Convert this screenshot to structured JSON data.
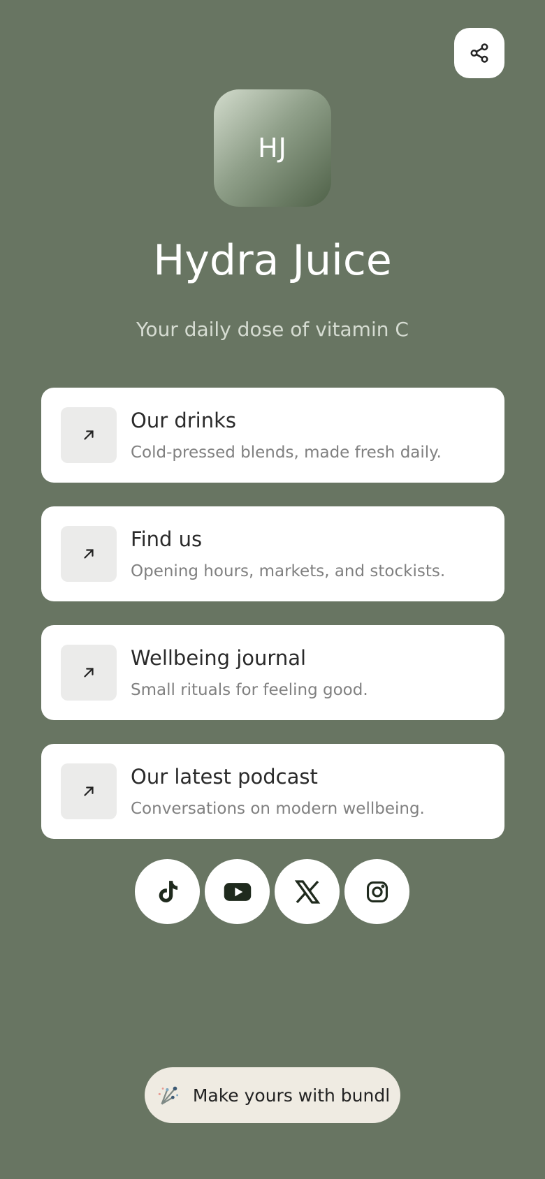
{
  "profile": {
    "initials": "HJ",
    "name": "Hydra Juice",
    "tagline": "Your daily dose of vitamin C"
  },
  "links": [
    {
      "title": "Our drinks",
      "description": "Cold-pressed blends, made fresh daily.",
      "icon": "arrow-up-right-icon"
    },
    {
      "title": "Find us",
      "description": "Opening hours, markets, and stockists.",
      "icon": "arrow-up-right-icon"
    },
    {
      "title": "Wellbeing journal",
      "description": "Small rituals for feeling good.",
      "icon": "arrow-up-right-icon"
    },
    {
      "title": "Our latest podcast",
      "description": "Conversations on modern wellbeing.",
      "icon": "arrow-up-right-icon"
    }
  ],
  "socials": [
    "tiktok-icon",
    "youtube-icon",
    "x-icon",
    "instagram-icon"
  ],
  "footer": {
    "label": "Make yours with bundl",
    "icon": "bundl-logo-icon"
  },
  "colors": {
    "background": "#687562",
    "card": "#ffffff",
    "icon_tile": "#ebebea",
    "footer_pill": "#efebe2"
  }
}
